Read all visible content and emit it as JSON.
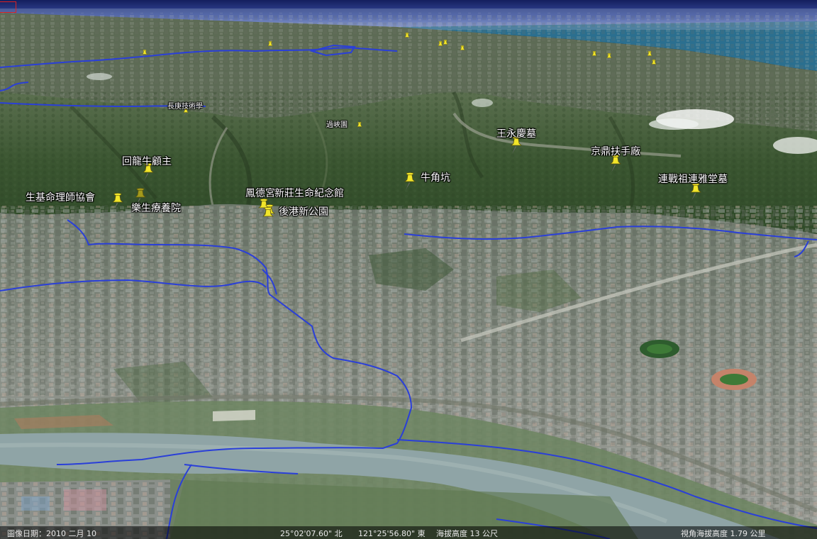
{
  "map": {
    "pins": [
      {
        "label": "長庚技術學",
        "size": "small"
      },
      {
        "label": "過峽園",
        "size": "small"
      },
      {
        "label": "王永慶墓",
        "size": "normal"
      },
      {
        "label": "京鼎扶手廠",
        "size": "normal"
      },
      {
        "label": "回龍牛顧主",
        "size": "normal"
      },
      {
        "label": "牛角坑",
        "size": "normal"
      },
      {
        "label": "連戰祖連雅堂墓",
        "size": "normal"
      },
      {
        "label": "生基命理師協會",
        "size": "normal"
      },
      {
        "label": "樂生療養院",
        "size": "normal"
      },
      {
        "label": "鳳德宮",
        "size": "normal"
      },
      {
        "label": "新莊生命紀念館",
        "size": "normal"
      },
      {
        "label": "後港新公園",
        "size": "normal"
      }
    ],
    "distant_pins_count": 10
  },
  "status": {
    "imagery_date": "圖像日期：2010 二月 10",
    "latitude": "25°02'07.60\" 北",
    "longitude": "121°25'56.80\" 東",
    "elevation": "海拔高度   13 公尺",
    "eye_altitude": "視角海拔高度     1.79 公里"
  },
  "colors": {
    "pin_yellow": "#f2e62a",
    "pin_olive": "#a39a1c",
    "boundary_blue": "#2a3fd8",
    "sky_top": "#1a2a70",
    "sea": "#2b6f8f",
    "mountain": "#3d5a2f",
    "urban": "#8f978e",
    "river": "#8ea3a3"
  }
}
